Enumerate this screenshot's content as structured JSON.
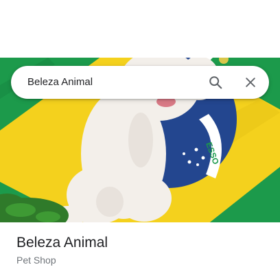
{
  "search": {
    "query": "Beleza Animal",
    "search_icon": "search-icon",
    "close_icon": "close-icon"
  },
  "photo": {
    "flag_text": "ORDEM E PROGRESSO",
    "colors": {
      "green": "#1a9a4a",
      "yellow": "#f5d21c",
      "blue": "#22468f",
      "dog": "#f3efea"
    }
  },
  "place": {
    "name": "Beleza Animal",
    "category": "Pet Shop"
  }
}
